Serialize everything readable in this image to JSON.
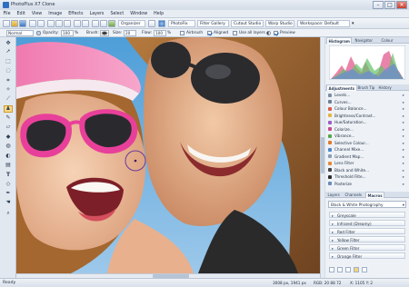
{
  "window": {
    "title": "PhotoPlus X7 Clone",
    "min": "–",
    "max": "□",
    "close": "✕"
  },
  "menu": [
    "File",
    "Edit",
    "View",
    "Image",
    "Effects",
    "Layers",
    "Select",
    "Window",
    "Help"
  ],
  "toolbar": {
    "organizer": "Organizer",
    "photofix": "PhotoFix",
    "filter_gallery": "Filter Gallery",
    "cutout_studio": "Cutout Studio",
    "warp_studio": "Warp Studio",
    "workspace": "Workspace: Default"
  },
  "options": {
    "blend_mode": "Normal",
    "opacity_label": "Opacity:",
    "opacity_value": "100",
    "opacity_unit": "%",
    "brush_label": "Brush:",
    "size_label": "Size:",
    "size_value": "20",
    "flow_label": "Flow:",
    "flow_value": "100",
    "flow_unit": "%",
    "airbrush_label": "Airbrush",
    "aligned_label": "Aligned",
    "use_all_layers_label": "Use all layers",
    "preview_label": "Preview"
  },
  "panels": {
    "top_tabs": [
      "Histogram",
      "Navigator",
      "Colour"
    ],
    "adj_tabs": [
      "Adjustments",
      "Brush Tip",
      "History"
    ],
    "adjustments": [
      {
        "label": "Levels...",
        "color": "#7c8da6"
      },
      {
        "label": "Curves...",
        "color": "#6d7f99"
      },
      {
        "label": "Colour Balance...",
        "color": "#d65b4b"
      },
      {
        "label": "Brightness/Contrast...",
        "color": "#e2b640"
      },
      {
        "label": "Hue/Saturation...",
        "color": "#9c5fc4"
      },
      {
        "label": "Colorize...",
        "color": "#c84a8c"
      },
      {
        "label": "Vibrance...",
        "color": "#58a548"
      },
      {
        "label": "Selective Colour...",
        "color": "#e07a2e"
      },
      {
        "label": "Channel Mixe...",
        "color": "#4d86c9"
      },
      {
        "label": "Gradient Map...",
        "color": "#8a9db5"
      },
      {
        "label": "Lens Filter",
        "color": "#e58a3a"
      },
      {
        "label": "Black and White...",
        "color": "#454545"
      },
      {
        "label": "Threshold Filte...",
        "color": "#2d2d2d"
      },
      {
        "label": "Posterize",
        "color": "#6b8cb8"
      }
    ],
    "macro_tabs": [
      "Layers",
      "Channels",
      "Macros"
    ],
    "macro_category": "Black & White Photography",
    "macros": [
      "Greyscale",
      "Infrared (Dreamy)",
      "Red Filter",
      "Yellow Filter",
      "Green Filter",
      "Orange Filter"
    ]
  },
  "status": {
    "left": "Ready",
    "dims": "3008 px, 1941 px",
    "rgb": "RGB: 20 88 72",
    "coords": "X: 1105 Y: 2"
  },
  "colors": {
    "accent": "#2f6fc0",
    "sky": "#5aa8e0",
    "panel": "#eef2f7"
  }
}
